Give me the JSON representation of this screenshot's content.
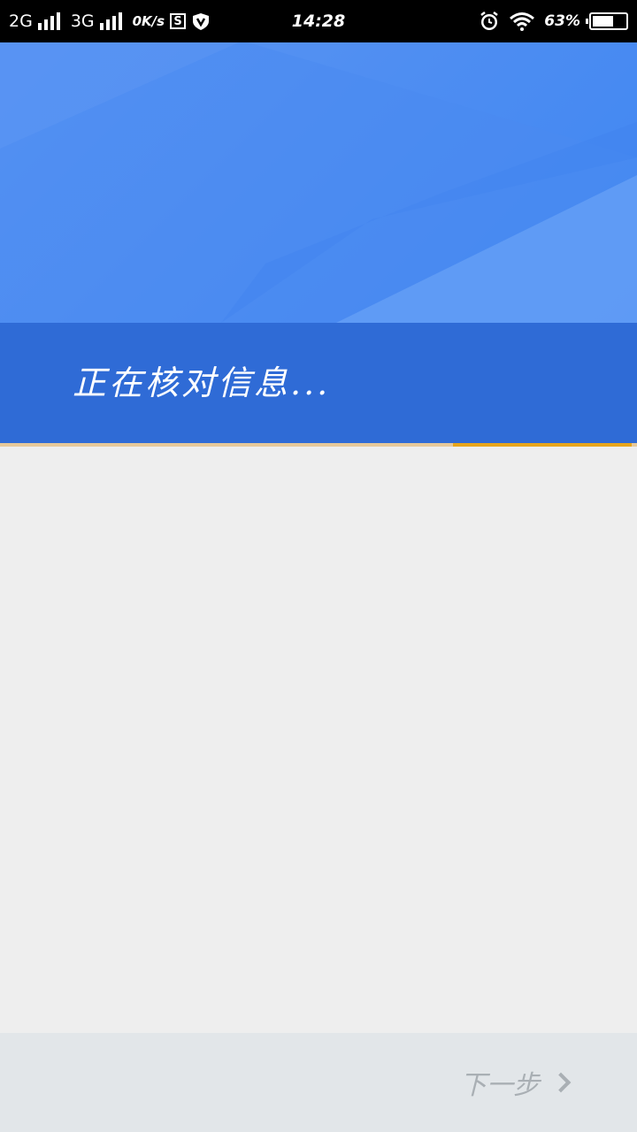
{
  "status_bar": {
    "network_1": "2G",
    "network_2": "3G",
    "speed": "0K/s",
    "s_badge": "S",
    "vpn_icon": "v-shield-icon",
    "time": "14:28",
    "alarm_icon": "alarm-clock-icon",
    "wifi_icon": "wifi-icon",
    "battery_percent": "63%",
    "battery_level": 0.63
  },
  "main": {
    "status_message": "正在核对信息..."
  },
  "progress": {
    "fraction": 0.28,
    "track_color": "#e6c89a",
    "fill_color": "#e7a51c"
  },
  "footer": {
    "next_label": "下一步",
    "next_icon": "chevron-right-icon"
  },
  "colors": {
    "hero_blue": "#4f8ef2",
    "band_blue": "#2f6bd6",
    "background": "#eeeeee",
    "footer_bg": "#e2e6e9",
    "disabled_text": "#a9afb4"
  }
}
